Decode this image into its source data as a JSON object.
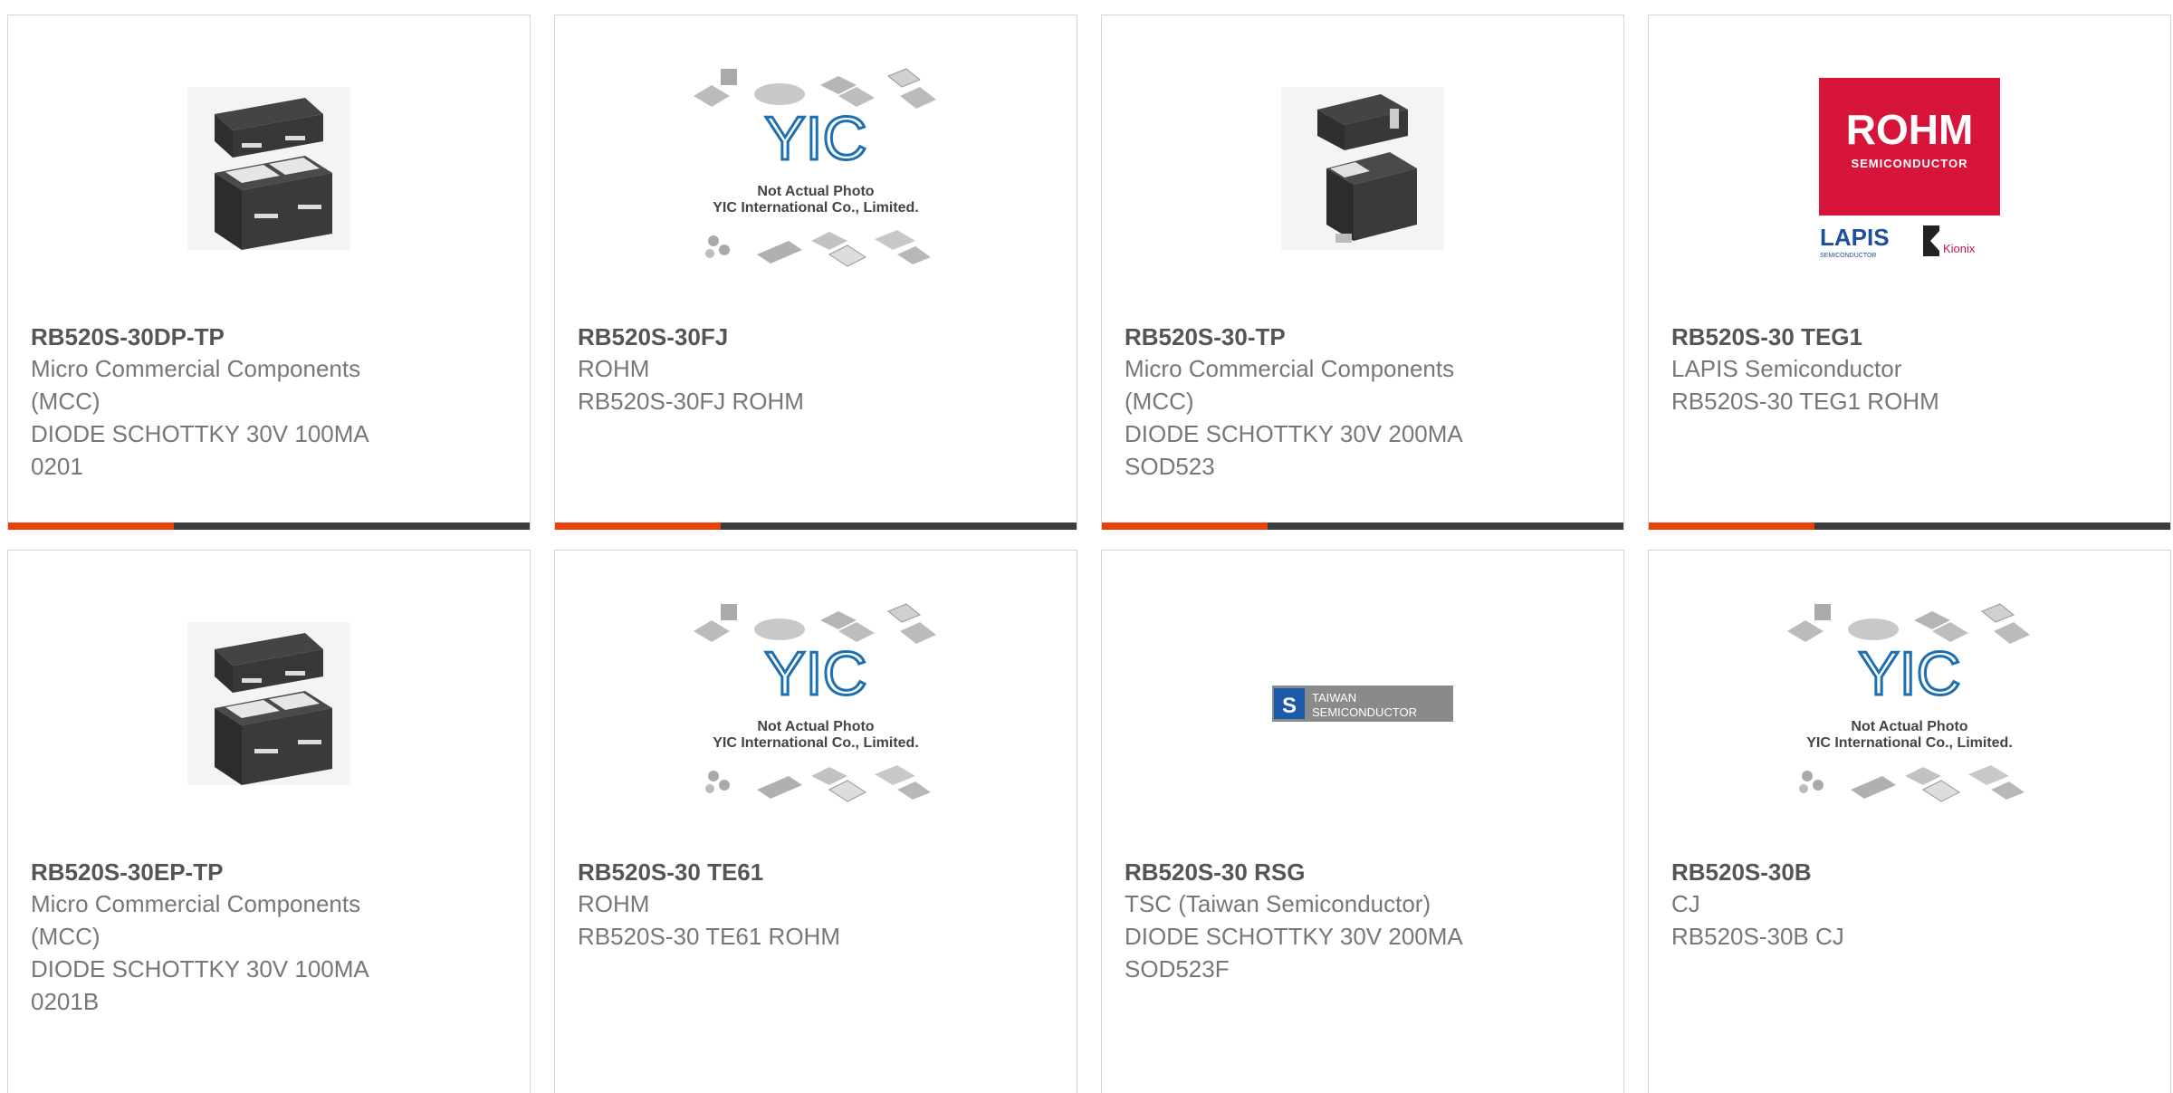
{
  "products": [
    {
      "part": "RB520S-30DP-TP",
      "manufacturer": "Micro Commercial Components (MCC)",
      "description": "DIODE SCHOTTKY 30V 100MA 0201",
      "image": "dual-chip-package"
    },
    {
      "part": "RB520S-30FJ",
      "manufacturer": "ROHM",
      "description": "RB520S-30FJ ROHM",
      "image": "yic-placeholder"
    },
    {
      "part": "RB520S-30-TP",
      "manufacturer": "Micro Commercial Components (MCC)",
      "description": "DIODE SCHOTTKY 30V 200MA SOD523",
      "image": "sod523-package"
    },
    {
      "part": "RB520S-30 TEG1",
      "manufacturer": "LAPIS Semiconductor",
      "description": "RB520S-30 TEG1 ROHM",
      "image": "rohm-lapis-logo"
    },
    {
      "part": "RB520S-30EP-TP",
      "manufacturer": "Micro Commercial Components (MCC)",
      "description": "DIODE SCHOTTKY 30V 100MA 0201B",
      "image": "dual-chip-package"
    },
    {
      "part": "RB520S-30 TE61",
      "manufacturer": "ROHM",
      "description": "RB520S-30 TE61 ROHM",
      "image": "yic-placeholder"
    },
    {
      "part": "RB520S-30 RSG",
      "manufacturer": "TSC (Taiwan Semiconductor)",
      "description": "DIODE SCHOTTKY 30V 200MA SOD523F",
      "image": "tsc-logo"
    },
    {
      "part": "RB520S-30B",
      "manufacturer": "CJ",
      "description": "RB520S-30B CJ",
      "image": "yic-placeholder"
    }
  ],
  "placeholder": {
    "line1": "Not Actual Photo",
    "line2": "YIC International Co., Limited.",
    "mark": "YIC"
  },
  "logos": {
    "rohm": "ROHM",
    "rohm_sub": "SEMICONDUCTOR",
    "lapis": "LAPIS",
    "lapis_sub": "SEMICONDUCTOR",
    "kionix": "Kionix",
    "tsc_line1": "TAIWAN",
    "tsc_line2": "SEMICONDUCTOR"
  },
  "colors": {
    "accent": "#e8420a",
    "bar": "#3d3d3d",
    "rohm_red": "#d7153a",
    "border": "#d6d6d6"
  }
}
